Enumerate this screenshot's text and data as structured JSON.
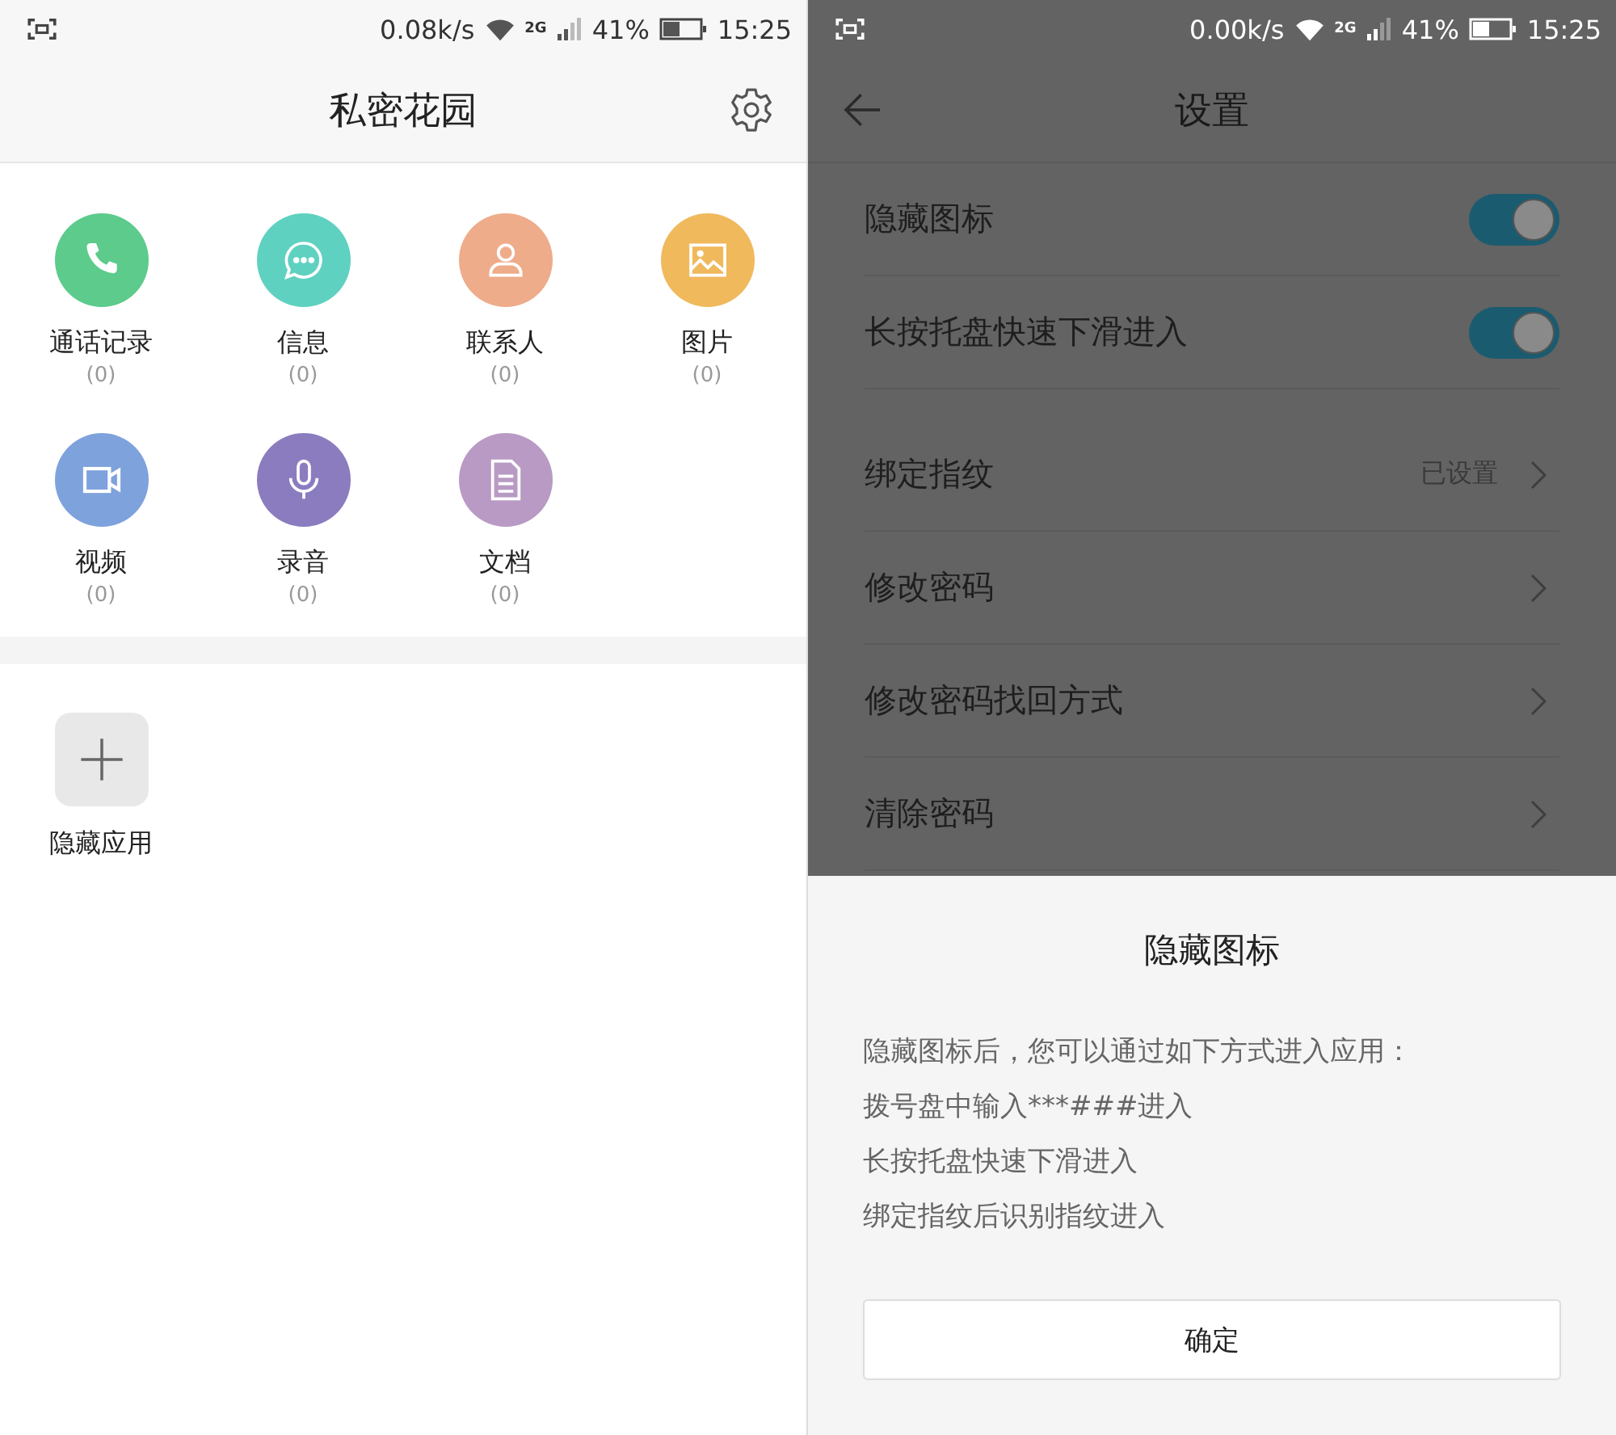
{
  "left_screen": {
    "status_bar": {
      "speed": "0.08k/s",
      "network": "2G",
      "battery": "41%",
      "time": "15:25"
    },
    "title": "私密花园",
    "categories": [
      {
        "label": "通话记录",
        "count": "(0)",
        "color": "#5ccb8c"
      },
      {
        "label": "信息",
        "count": "(0)",
        "color": "#5fd1c0"
      },
      {
        "label": "联系人",
        "count": "(0)",
        "color": "#eeac8a"
      },
      {
        "label": "图片",
        "count": "(0)",
        "color": "#f0b95c"
      },
      {
        "label": "视频",
        "count": "(0)",
        "color": "#7ea2dc"
      },
      {
        "label": "录音",
        "count": "(0)",
        "color": "#8b7cc0"
      },
      {
        "label": "文档",
        "count": "(0)",
        "color": "#b89ac4"
      }
    ],
    "hidden_apps": {
      "label": "隐藏应用"
    }
  },
  "right_screen": {
    "status_bar": {
      "speed": "0.00k/s",
      "network": "2G",
      "battery": "41%",
      "time": "15:25"
    },
    "title": "设置",
    "settings": [
      {
        "label": "隐藏图标",
        "kind": "toggle",
        "on": true
      },
      {
        "label": "长按托盘快速下滑进入",
        "kind": "toggle",
        "on": true
      },
      {
        "label": "绑定指纹",
        "kind": "link",
        "value": "已设置"
      },
      {
        "label": "修改密码",
        "kind": "link"
      },
      {
        "label": "修改密码找回方式",
        "kind": "link"
      },
      {
        "label": "清除密码",
        "kind": "link"
      }
    ],
    "dialog": {
      "title": "隐藏图标",
      "lines": [
        "隐藏图标后，您可以通过如下方式进入应用：",
        "拨号盘中输入***###进入",
        "长按托盘快速下滑进入",
        "绑定指纹后识别指纹进入"
      ],
      "button": "确定"
    }
  }
}
